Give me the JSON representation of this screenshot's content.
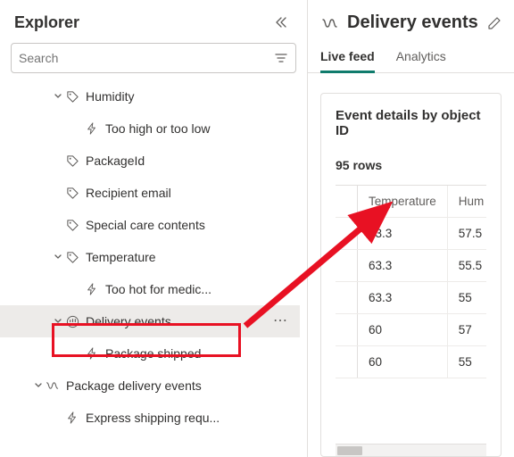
{
  "explorer": {
    "title": "Explorer",
    "search_placeholder": "Search",
    "tree": [
      {
        "indent": 2,
        "chev": "down",
        "icon": "tag",
        "label": "Humidity"
      },
      {
        "indent": 3,
        "chev": "",
        "icon": "bolt",
        "label": "Too high or too low"
      },
      {
        "indent": 2,
        "chev": "",
        "icon": "tag",
        "label": "PackageId"
      },
      {
        "indent": 2,
        "chev": "",
        "icon": "tag",
        "label": "Recipient email"
      },
      {
        "indent": 2,
        "chev": "",
        "icon": "tag",
        "label": "Special care contents"
      },
      {
        "indent": 2,
        "chev": "down",
        "icon": "tag",
        "label": "Temperature"
      },
      {
        "indent": 3,
        "chev": "",
        "icon": "bolt",
        "label": "Too hot for medic..."
      },
      {
        "indent": 2,
        "chev": "down",
        "icon": "stream",
        "label": "Delivery events",
        "selected": true,
        "dots": true
      },
      {
        "indent": 3,
        "chev": "",
        "icon": "bolt",
        "label": "Package shipped"
      },
      {
        "indent": 1,
        "chev": "down",
        "icon": "flow",
        "label": "Package delivery events"
      },
      {
        "indent": 2,
        "chev": "",
        "icon": "bolt",
        "label": "Express shipping requ..."
      }
    ]
  },
  "detail": {
    "title": "Delivery events",
    "tabs": {
      "live": "Live feed",
      "analytics": "Analytics"
    },
    "card_title": "Event details by object ID",
    "row_count": "95 rows",
    "columns": [
      "",
      "Temperature",
      "Hum"
    ],
    "rows": [
      [
        "",
        "63.3",
        "57.5"
      ],
      [
        "",
        "63.3",
        "55.5"
      ],
      [
        "",
        "63.3",
        "55"
      ],
      [
        "",
        "60",
        "57"
      ],
      [
        "",
        "60",
        "55"
      ]
    ]
  }
}
